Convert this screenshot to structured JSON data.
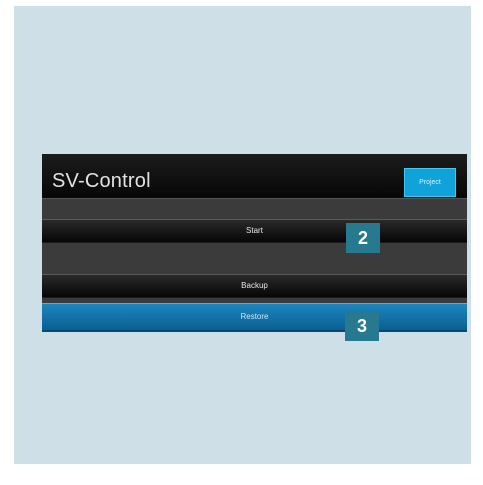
{
  "app": {
    "title": "SV-Control",
    "project_button_label": "Project"
  },
  "menu": {
    "start_label": "Start",
    "backup_label": "Backup",
    "restore_label": "Restore"
  },
  "callouts": {
    "start": "2",
    "restore": "3"
  },
  "colors": {
    "background_panel": "#cfdfe8",
    "header": "#070707",
    "project_button": "#0fa3d9",
    "restore_button": "#1d86be",
    "callout": "#26798f"
  }
}
